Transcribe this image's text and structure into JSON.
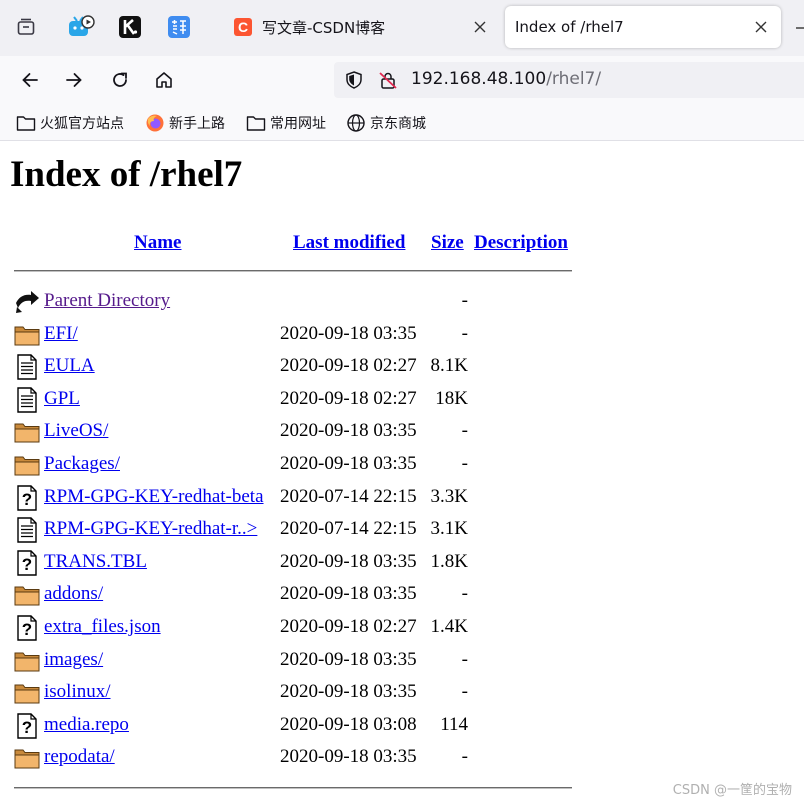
{
  "browser": {
    "tabs": [
      {
        "title": "写文章-CSDN博客",
        "close": "✕"
      },
      {
        "title": "Index of /rhel7",
        "close": "✕"
      }
    ],
    "url": {
      "host": "192.168.48.100",
      "path": "/rhel7/"
    },
    "bookmarks": [
      "火狐官方站点",
      "新手上路",
      "常用网址",
      "京东商城"
    ]
  },
  "page": {
    "title": "Index of /rhel7",
    "columns": {
      "name": "Name",
      "modified": "Last modified",
      "size": "Size",
      "description": "Description"
    },
    "rows": [
      {
        "type": "parent",
        "name": "Parent Directory",
        "date": "",
        "size": "-"
      },
      {
        "type": "folder",
        "name": "EFI/",
        "date": "2020-09-18 03:35",
        "size": "-"
      },
      {
        "type": "text",
        "name": "EULA",
        "date": "2020-09-18 02:27",
        "size": "8.1K"
      },
      {
        "type": "text",
        "name": "GPL",
        "date": "2020-09-18 02:27",
        "size": "18K"
      },
      {
        "type": "folder",
        "name": "LiveOS/",
        "date": "2020-09-18 03:35",
        "size": "-"
      },
      {
        "type": "folder",
        "name": "Packages/",
        "date": "2020-09-18 03:35",
        "size": "-"
      },
      {
        "type": "unknown",
        "name": "RPM-GPG-KEY-redhat-beta",
        "date": "2020-07-14 22:15",
        "size": "3.3K"
      },
      {
        "type": "text",
        "name": "RPM-GPG-KEY-redhat-r..>",
        "date": "2020-07-14 22:15",
        "size": "3.1K"
      },
      {
        "type": "unknown",
        "name": "TRANS.TBL",
        "date": "2020-09-18 03:35",
        "size": "1.8K"
      },
      {
        "type": "folder",
        "name": "addons/",
        "date": "2020-09-18 03:35",
        "size": "-"
      },
      {
        "type": "unknown",
        "name": "extra_files.json",
        "date": "2020-09-18 02:27",
        "size": "1.4K"
      },
      {
        "type": "folder",
        "name": "images/",
        "date": "2020-09-18 03:35",
        "size": "-"
      },
      {
        "type": "folder",
        "name": "isolinux/",
        "date": "2020-09-18 03:35",
        "size": "-"
      },
      {
        "type": "unknown",
        "name": "media.repo",
        "date": "2020-09-18 03:08",
        "size": "114"
      },
      {
        "type": "folder",
        "name": "repodata/",
        "date": "2020-09-18 03:35",
        "size": "-"
      }
    ]
  },
  "watermark": "CSDN @一筐的宝物"
}
